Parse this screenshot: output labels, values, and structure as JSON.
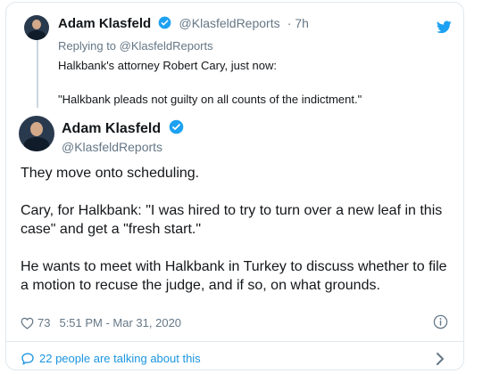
{
  "quoted_tweet": {
    "author_name": "Adam Klasfeld",
    "author_handle": "@KlasfeldReports",
    "time_ago": "· 7h",
    "replying_to": "Replying to @KlasfeldReports",
    "text_line1": "Halkbank's attorney Robert Cary, just now:",
    "text_line2": "\"Halkbank pleads not guilty on all counts of the indictment.\""
  },
  "main_tweet": {
    "author_name": "Adam Klasfeld",
    "author_handle": "@KlasfeldReports",
    "paragraph1": "They move onto scheduling.",
    "paragraph2": "Cary, for Halkbank: \"I was hired to try to turn over a new leaf in this case\" and get a \"fresh start.\"",
    "paragraph3": "He wants to meet with Halkbank in Turkey to discuss whether to file a motion to recuse the judge, and if so, on what grounds.",
    "likes": "73",
    "timestamp": "5:51 PM - Mar 31, 2020"
  },
  "footer": {
    "talking": "22 people are talking about this"
  },
  "icons": {
    "bird": "twitter-bird-icon",
    "verified": "verified-badge-icon",
    "heart": "heart-icon",
    "info": "info-icon",
    "chat": "chat-bubble-icon",
    "chevron": "chevron-right-icon"
  },
  "colors": {
    "brand_blue": "#1da1f2",
    "link_blue": "#1b95e0",
    "secondary_text": "#657786",
    "border": "#e1e8ed"
  }
}
